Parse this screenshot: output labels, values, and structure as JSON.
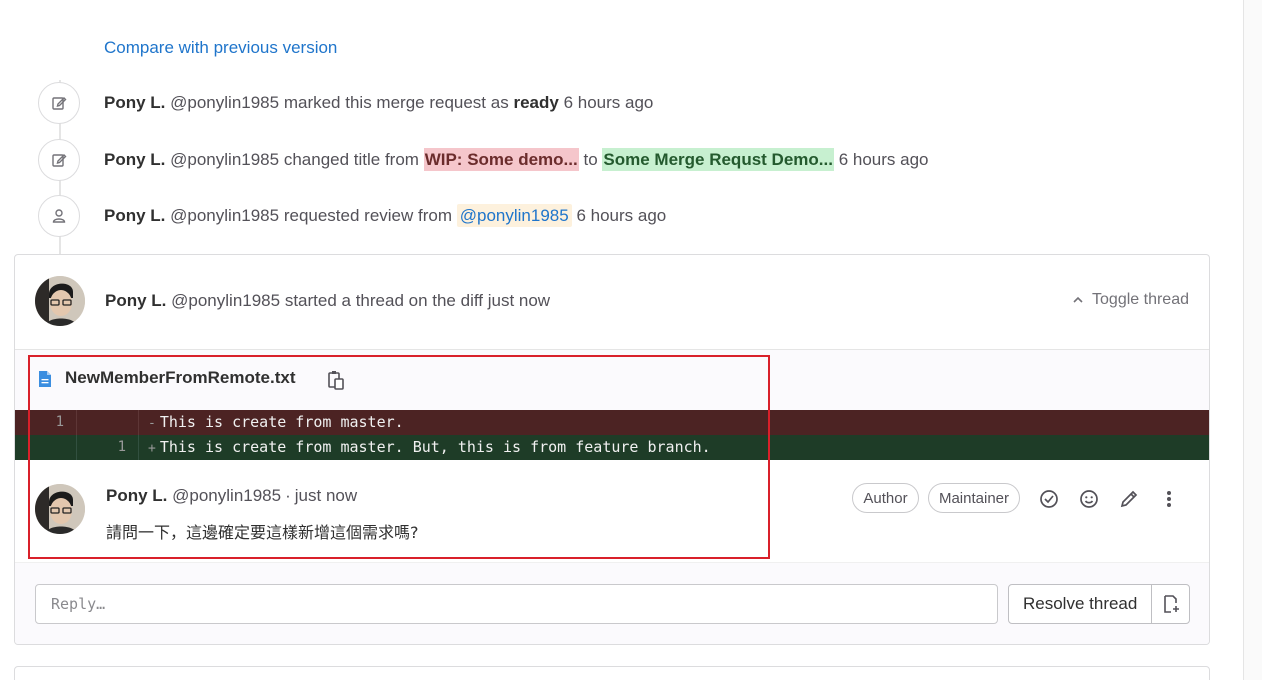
{
  "top_list": {
    "sha": "19448261"
  },
  "compare_link": "Compare with previous version",
  "system_notes": [
    {
      "icon": "pencil-square-icon",
      "author": "Pony L.",
      "handle": "@ponylin1985",
      "action": "marked this merge request as",
      "status": "ready",
      "time": "6 hours ago"
    },
    {
      "icon": "pencil-square-icon",
      "author": "Pony L.",
      "handle": "@ponylin1985",
      "action": "changed title from",
      "old_title": "WIP: Some demo...",
      "connector": "to",
      "new_title": "Some Merge Requst Demo...",
      "time": "6 hours ago"
    },
    {
      "icon": "user-icon",
      "author": "Pony L.",
      "handle": "@ponylin1985",
      "action": "requested review from",
      "reviewer": "@ponylin1985",
      "time": "6 hours ago"
    }
  ],
  "thread": {
    "author": "Pony L.",
    "handle": "@ponylin1985",
    "action": "started a thread on the diff just now",
    "toggle_label": "Toggle thread",
    "file_name": "NewMemberFromRemote.txt",
    "diff": {
      "old_line": {
        "number": "1",
        "sign": "-",
        "text": "This is create from master."
      },
      "new_line": {
        "number": "1",
        "sign": "+",
        "text": "This is create from master. But, this is from feature branch."
      }
    },
    "comment": {
      "author": "Pony L.",
      "handle": "@ponylin1985",
      "separator": "·",
      "time": "just now",
      "body": "請問一下，這邊確定要這樣新增這個需求嗎?",
      "badges": [
        "Author",
        "Maintainer"
      ]
    },
    "reply_placeholder": "Reply…",
    "resolve_label": "Resolve thread"
  }
}
